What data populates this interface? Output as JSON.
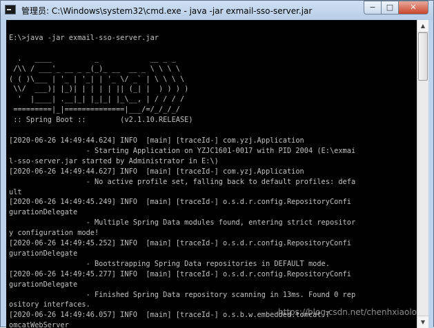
{
  "window": {
    "title": "管理员: C:\\Windows\\system32\\cmd.exe - java  -jar exmail-sso-server.jar",
    "minimize_glyph": "−",
    "maximize_glyph": "□",
    "close_glyph": "✕",
    "icon": "cmd-console-icon",
    "close_color": "#c9462c"
  },
  "console": {
    "text_color": "#c0c0c0",
    "background": "#000000",
    "lines": [
      "",
      "E:\\>java -jar exmail-sso-server.jar",
      "",
      "  .   ____          _            __ _ _",
      " /\\\\ / ___'_ __ _ _(_)_ __  __ _ \\ \\ \\ \\",
      "( ( )\\___ | '_ | '_| | '_ \\/ _` | \\ \\ \\ \\",
      " \\\\/  ___)| |_)| | | | | || (_| |  ) ) ) )",
      "  '  |____| .__|_| |_|_| |_\\__, | / / / /",
      " =========|_|==============|___/=/_/_/_/",
      " :: Spring Boot ::        (v2.1.10.RELEASE)",
      "",
      "[2020-06-26 14:49:44.624] INFO  [main] [traceId-] com.yzj.Application",
      "                  - Starting Application on YZJC1601-0017 with PID 2004 (E:\\exmai",
      "l-sso-server.jar started by Administrator in E:\\)",
      "[2020-06-26 14:49:44.627] INFO  [main] [traceId-] com.yzj.Application",
      "                  - No active profile set, falling back to default profiles: defa",
      "ult",
      "[2020-06-26 14:49:45.249] INFO  [main] [traceId-] o.s.d.r.config.RepositoryConfi",
      "gurationDelegate",
      "                  - Multiple Spring Data modules found, entering strict repositor",
      "y configuration mode!",
      "[2020-06-26 14:49:45.252] INFO  [main] [traceId-] o.s.d.r.config.RepositoryConfi",
      "gurationDelegate",
      "                  - Bootstrapping Spring Data repositories in DEFAULT mode.",
      "[2020-06-26 14:49:45.277] INFO  [main] [traceId-] o.s.d.r.config.RepositoryConfi",
      "gurationDelegate",
      "                  - Finished Spring Data repository scanning in 13ms. Found 0 rep",
      "ository interfaces.",
      "[2020-06-26 14:49:46.057] INFO  [main] [traceId-] o.s.b.w.embedded.tomcat.T",
      "omcatWebServer"
    ]
  },
  "scrollbar": {
    "up_glyph": "▲",
    "down_glyph": "▼"
  },
  "watermark": "https://blog.csdn.net/chenhxiaolo"
}
